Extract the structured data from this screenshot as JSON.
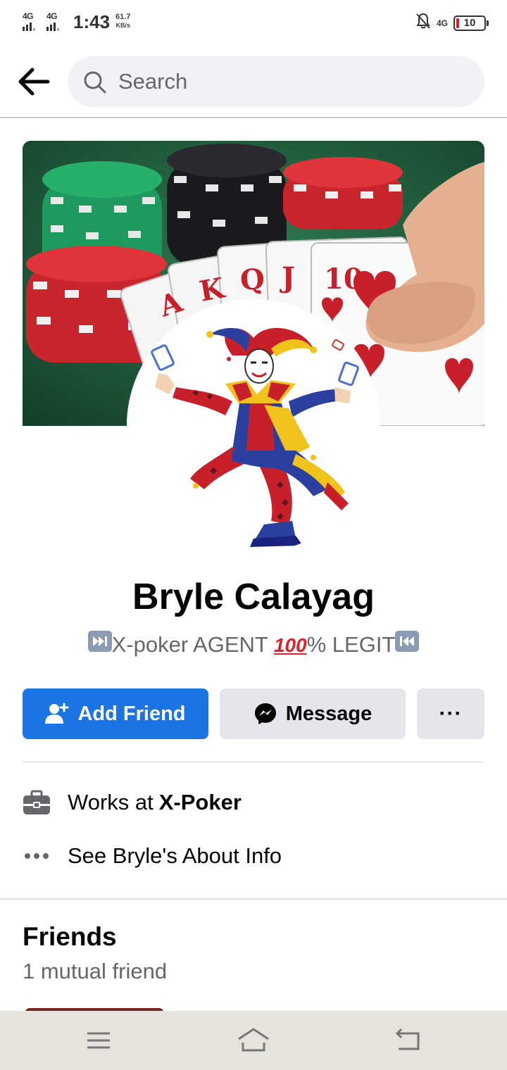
{
  "status_bar": {
    "signal1_label": "4G",
    "signal2_label": "4G",
    "time": "1:43",
    "speed_value": "61.7",
    "speed_unit": "KB/s",
    "network_label": "4G",
    "battery": "10"
  },
  "header": {
    "search_placeholder": "Search"
  },
  "profile": {
    "name": "Bryle Calayag",
    "bio_text": "X-poker AGENT ",
    "bio_hundred": "100",
    "bio_suffix": "% LEGIT"
  },
  "actions": {
    "add_friend": "Add Friend",
    "message": "Message",
    "more": "···"
  },
  "about": {
    "work_prefix": "Works at",
    "work_company": "X-Poker",
    "see_about": "See Bryle's About Info"
  },
  "friends": {
    "title": "Friends",
    "mutual": "1 mutual friend"
  },
  "colors": {
    "primary": "#1b74e4",
    "secondary_button": "#e4e6eb",
    "muted_text": "#65676b"
  },
  "icons": {
    "back": "arrow-left-icon",
    "search": "search-icon",
    "add_friend": "person-add-icon",
    "message": "messenger-icon",
    "work": "briefcase-icon",
    "about": "more-horizontal-icon",
    "nav_menu": "menu-icon",
    "nav_home": "home-icon",
    "nav_back": "back-icon"
  }
}
